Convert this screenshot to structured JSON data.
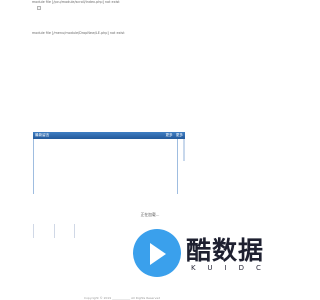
{
  "errors": {
    "line1": "module file [/pcu/module/scroll/index.php] not exist",
    "line2": "module file [/menu/module/DropNew/LE.php] not exist"
  },
  "panel": {
    "title": "最新留言",
    "actions": [
      "更多",
      "更多"
    ]
  },
  "center_text": "正在加载...",
  "logo": {
    "cn": "酷数据",
    "en": "KUIDC"
  },
  "footer": "Copyright © 2019 ____________ All Rights Reserved"
}
